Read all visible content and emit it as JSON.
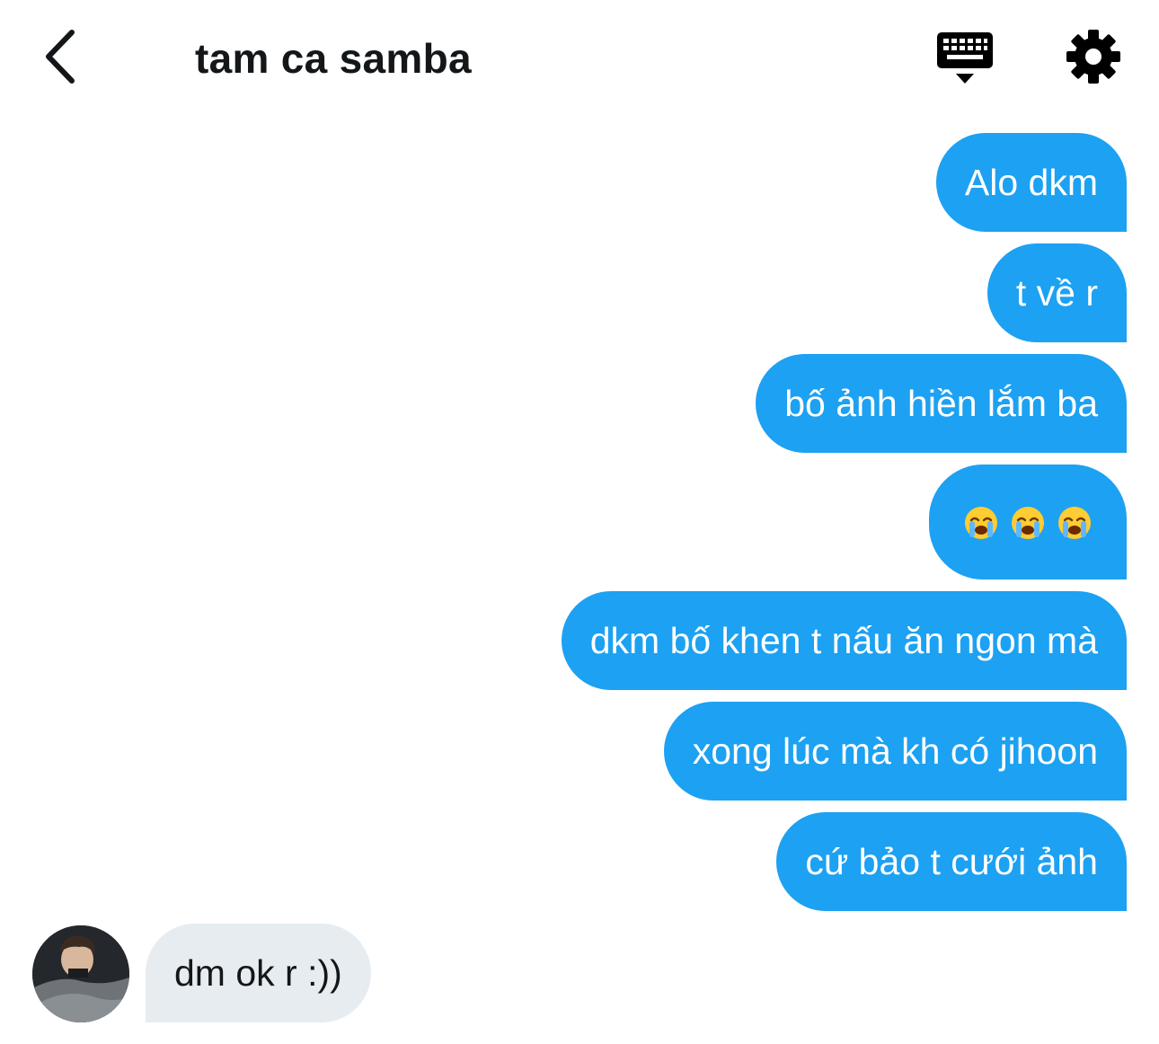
{
  "header": {
    "title": "tam ca samba",
    "back_icon": "chevron-left-icon",
    "keyboard_icon": "keyboard-icon",
    "settings_icon": "gear-icon"
  },
  "messages_outgoing": [
    {
      "text": "Alo dkm"
    },
    {
      "text": "t về r"
    },
    {
      "text": "bố ảnh hiền lắm ba"
    },
    {
      "text": "",
      "emoji": [
        "loudly-crying-face",
        "loudly-crying-face",
        "loudly-crying-face"
      ]
    },
    {
      "text": "dkm bố khen t nấu ăn ngon mà"
    },
    {
      "text": "xong lúc mà kh có jihoon"
    },
    {
      "text": "cứ bảo t cưới ảnh"
    }
  ],
  "message_incoming": {
    "text": "dm ok r :))"
  },
  "colors": {
    "outgoing_bubble": "#1da1f2",
    "incoming_bubble": "#e6ecf0",
    "text_dark": "#14171a"
  }
}
